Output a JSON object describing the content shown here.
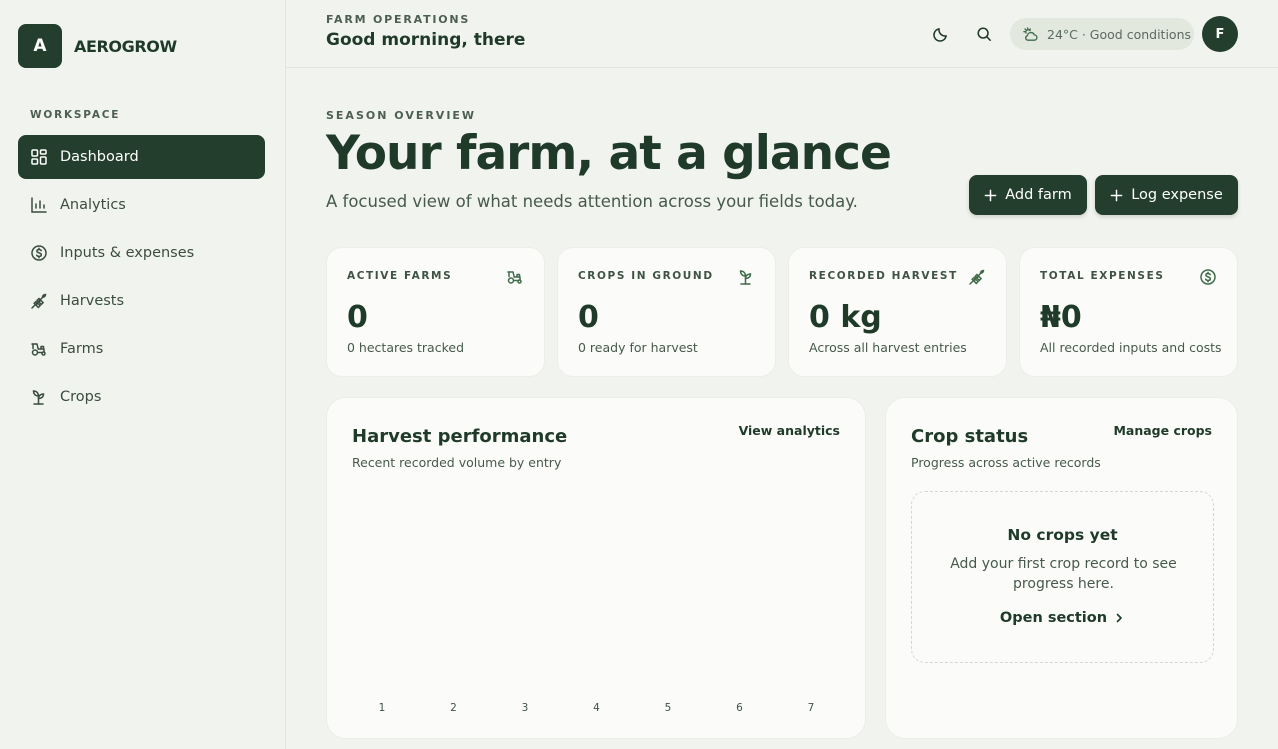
{
  "brand": {
    "mark": "A",
    "name": "AEROGROW"
  },
  "sidebar": {
    "section_label": "WORKSPACE",
    "items": [
      {
        "label": "Dashboard",
        "icon": "dashboard-grid-icon",
        "active": true
      },
      {
        "label": "Analytics",
        "icon": "bar-chart-icon",
        "active": false
      },
      {
        "label": "Inputs & expenses",
        "icon": "dollar-circle-icon",
        "active": false
      },
      {
        "label": "Harvests",
        "icon": "wheat-icon",
        "active": false
      },
      {
        "label": "Farms",
        "icon": "tractor-icon",
        "active": false
      },
      {
        "label": "Crops",
        "icon": "sprout-icon",
        "active": false
      }
    ]
  },
  "topbar": {
    "kicker": "FARM OPERATIONS",
    "title": "Good morning, there",
    "weather": "24°C · Good conditions",
    "avatar": "F"
  },
  "hero": {
    "kicker": "SEASON OVERVIEW",
    "title": "Your farm, at a glance",
    "subtitle": "A focused view of what needs attention across your fields today.",
    "add_farm": "Add farm",
    "log_expense": "Log expense"
  },
  "stats": [
    {
      "label": "ACTIVE FARMS",
      "value": "0",
      "note": "0 hectares tracked",
      "icon": "tractor-icon"
    },
    {
      "label": "CROPS IN GROUND",
      "value": "0",
      "note": "0 ready for harvest",
      "icon": "sprout-icon"
    },
    {
      "label": "RECORDED HARVEST",
      "value": "0 kg",
      "note": "Across all harvest entries",
      "icon": "wheat-icon"
    },
    {
      "label": "TOTAL EXPENSES",
      "value": "₦0",
      "note": "All recorded inputs and costs",
      "icon": "dollar-circle-icon"
    }
  ],
  "harvest_card": {
    "title": "Harvest performance",
    "subtitle": "Recent recorded volume by entry",
    "link": "View analytics"
  },
  "crop_card": {
    "title": "Crop status",
    "subtitle": "Progress across active records",
    "link": "Manage crops",
    "empty_title": "No crops yet",
    "empty_text": "Add your first crop record to see progress here.",
    "empty_link": "Open section"
  },
  "colors": {
    "accent": "#233e2c",
    "background": "#f1f3ee",
    "card": "#fbfcfa"
  },
  "chart_data": {
    "type": "bar",
    "categories": [
      "1",
      "2",
      "3",
      "4",
      "5",
      "6",
      "7"
    ],
    "values": [
      0,
      0,
      0,
      0,
      0,
      0,
      0
    ],
    "title": "Harvest performance",
    "subtitle": "Recent recorded volume by entry",
    "xlabel": "",
    "ylabel": "",
    "grid": false
  }
}
